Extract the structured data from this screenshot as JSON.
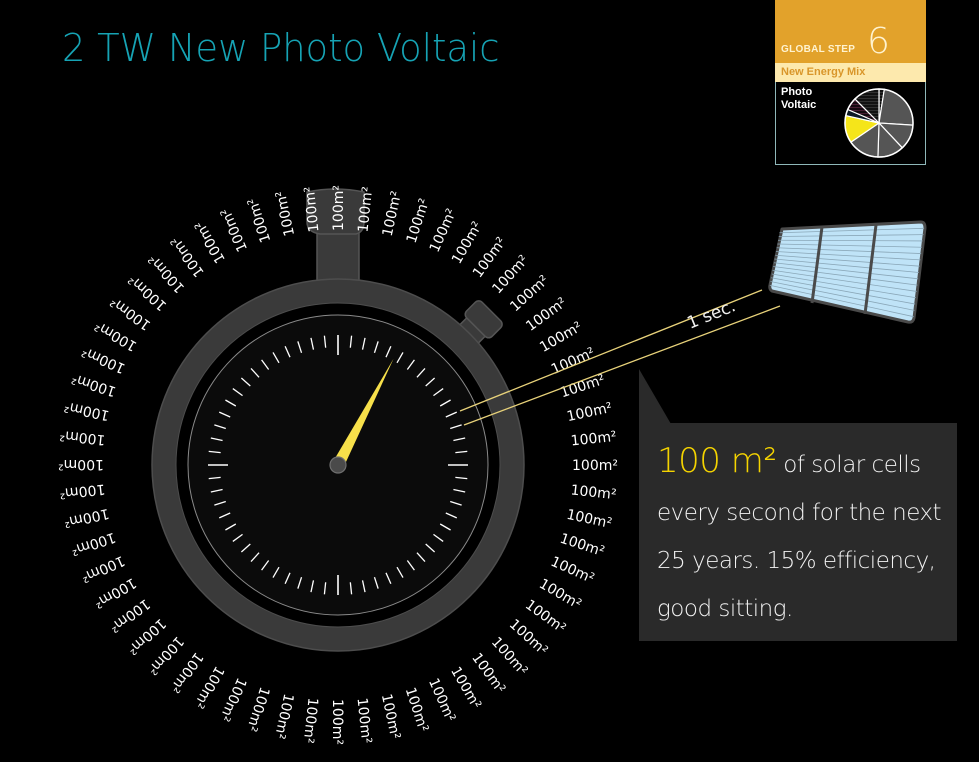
{
  "header": {
    "title": "2 TW New Photo Voltaic"
  },
  "step_card": {
    "label": "GLOBAL STEP",
    "number": "6",
    "subtitle": "New Energy Mix",
    "body_label_line1": "Photo",
    "body_label_line2": "Voltaic",
    "colors": {
      "header": "#e2a22b",
      "subtitle_bg": "#fde9ad",
      "highlight": "#f5e51a"
    },
    "pie_slices": [
      {
        "name": "striped-small",
        "fraction": 0.025,
        "color": "#111111",
        "striped": true
      },
      {
        "name": "gray-1",
        "fraction": 0.235,
        "color": "#555555"
      },
      {
        "name": "gray-2",
        "fraction": 0.12,
        "color": "#555555"
      },
      {
        "name": "gray-3",
        "fraction": 0.125,
        "color": "#555555"
      },
      {
        "name": "gray-4",
        "fraction": 0.15,
        "color": "#555555"
      },
      {
        "name": "photo-voltaic",
        "fraction": 0.13,
        "color": "#f5e51a",
        "highlighted": true
      },
      {
        "name": "dark-thin",
        "fraction": 0.03,
        "color": "#0d1a26"
      },
      {
        "name": "dark-pink-striped",
        "fraction": 0.06,
        "color": "#1a0a14",
        "striped": true
      },
      {
        "name": "striped-large",
        "fraction": 0.125,
        "color": "#111111",
        "striped": true
      }
    ]
  },
  "stopwatch": {
    "ring_label": "100m²",
    "ring_label_count": 60,
    "hand_seconds": 4.6,
    "tick_count": 60,
    "colors": {
      "body": "#3a3a3a",
      "edge": "#5a5a5a",
      "hand": "#f7e04a",
      "ticks": "#ffffff"
    }
  },
  "connector": {
    "label": "1 sec.",
    "color": "#e8d27a"
  },
  "solar_panel": {
    "cells": 3,
    "colors": {
      "fill": "#bfe3f7",
      "frame": "#4a4a4a",
      "lines": "#8aa7b8"
    }
  },
  "callout": {
    "highlight": "100 m²",
    "text": " of solar cells every second for the next 25 years. 15% efficiency, good sitting."
  }
}
